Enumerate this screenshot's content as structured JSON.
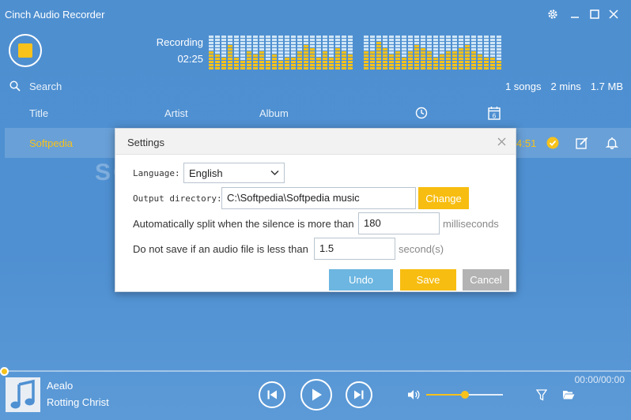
{
  "app": {
    "title": "Cinch Audio Recorder"
  },
  "window_controls": {
    "settings_icon": "gear-icon",
    "minimize_icon": "minimize-icon",
    "maximize_icon": "maximize-icon",
    "close_icon": "close-icon"
  },
  "recorder": {
    "status_label": "Recording",
    "elapsed": "02:25"
  },
  "colors": {
    "accent": "#f7c21b",
    "background": "#4f90d2",
    "meter_active": "#f7c21b",
    "meter_inactive": "#cfe5f5",
    "undo": "#6cb6e1",
    "save": "#f7bd10",
    "cancel": "#b3b3b3"
  },
  "level_meter": {
    "left": [
      0.55,
      0.45,
      0.35,
      0.7,
      0.4,
      0.3,
      0.5,
      0.45,
      0.55,
      0.3,
      0.45,
      0.3,
      0.4,
      0.35,
      0.5,
      0.7,
      0.6,
      0.4,
      0.55,
      0.35,
      0.65,
      0.55,
      0.45
    ],
    "right": [
      0.5,
      0.55,
      0.8,
      0.6,
      0.45,
      0.5,
      0.35,
      0.55,
      0.7,
      0.6,
      0.5,
      0.35,
      0.45,
      0.55,
      0.5,
      0.6,
      0.7,
      0.55,
      0.45,
      0.4,
      0.35,
      0.3
    ]
  },
  "search": {
    "label": "Search"
  },
  "stats": {
    "songs": "1 songs",
    "duration": "2 mins",
    "size": "1.7 MB"
  },
  "columns": {
    "title": "Title",
    "artist": "Artist",
    "album": "Album",
    "time_icon": "clock-icon",
    "date_icon": "calendar-icon",
    "date_day": "6"
  },
  "tracks": [
    {
      "title": "Softpedia",
      "duration": "4:51"
    }
  ],
  "settings_dialog": {
    "title": "Settings",
    "language_label": "Language:",
    "language_value": "English",
    "output_dir_label": "Output directory:",
    "output_dir_value": "C:\\Softpedia\\Softpedia music",
    "change_label": "Change",
    "split_label": "Automatically split when the silence is more than",
    "split_value": "180",
    "split_unit": "milliseconds",
    "min_length_label": "Do not save if an audio file is less than",
    "min_length_value": "1.5",
    "min_length_unit": "second(s)",
    "undo_label": "Undo",
    "save_label": "Save",
    "cancel_label": "Cancel"
  },
  "player": {
    "song_title": "Aealo",
    "song_artist": "Rotting Christ",
    "time": "00:00/00:00",
    "volume_fraction": 0.5,
    "progress_fraction": 0
  }
}
